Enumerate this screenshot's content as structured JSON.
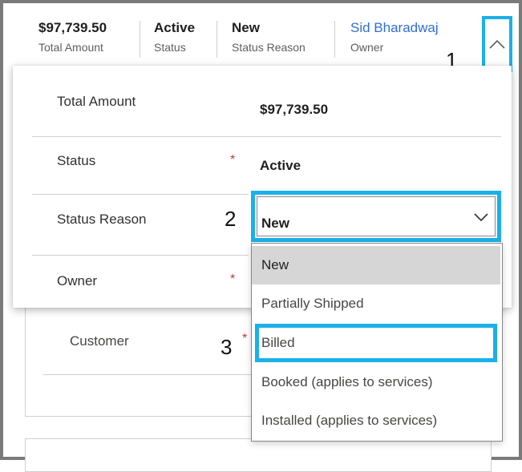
{
  "header": {
    "total_amount": {
      "value": "$97,739.50",
      "label": "Total Amount"
    },
    "status": {
      "value": "Active",
      "label": "Status"
    },
    "status_reason": {
      "value": "New",
      "label": "Status Reason"
    },
    "owner": {
      "value": "Sid Bharadwaj",
      "label": "Owner"
    },
    "expand_icon": "chevron-up-icon"
  },
  "callouts": {
    "one": "1",
    "two": "2",
    "three": "3"
  },
  "flyout": {
    "total_amount": {
      "label": "Total Amount",
      "value": "$97,739.50"
    },
    "status": {
      "label": "Status",
      "required": "*",
      "value": "Active"
    },
    "status_reason": {
      "label": "Status Reason",
      "selected": "New"
    },
    "owner": {
      "label": "Owner",
      "required": "*"
    }
  },
  "background": {
    "customer": {
      "label": "Customer",
      "required": "*"
    }
  },
  "dropdown": {
    "options": [
      "New",
      "Partially Shipped",
      "Billed",
      "Booked (applies to services)",
      "Installed (applies to services)"
    ],
    "selected_index": 0,
    "highlighted_index": 2
  },
  "colors": {
    "callout_border": "#1ab0e8",
    "required": "#c4314b",
    "owner_link": "#2f6fd6",
    "selected_option": "#d6d6d6"
  }
}
